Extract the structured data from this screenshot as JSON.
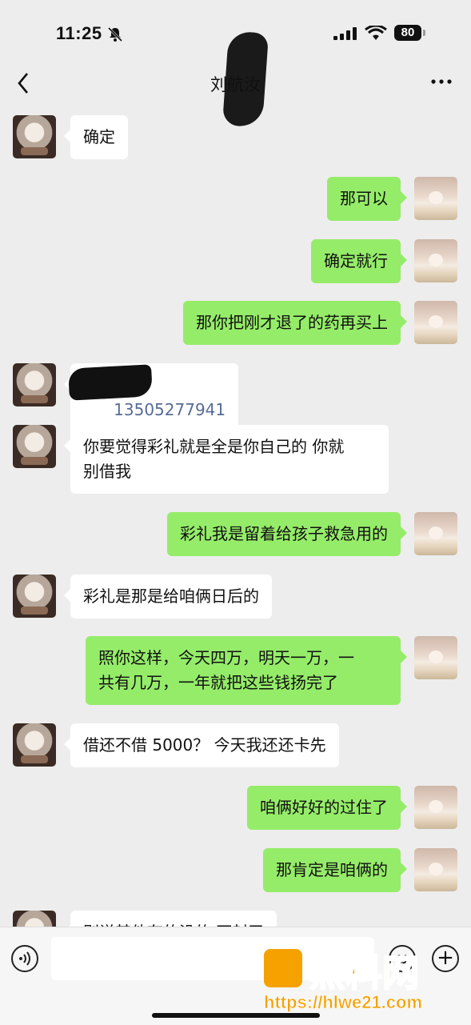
{
  "status_bar": {
    "time": "11:25",
    "battery": "80"
  },
  "header": {
    "title": "刘航汝"
  },
  "messages": [
    {
      "from": "other",
      "text": "确定"
    },
    {
      "from": "me",
      "text": "那可以"
    },
    {
      "from": "me",
      "text": "确定就行"
    },
    {
      "from": "me",
      "text": "那你把刚才退了的药再买上"
    },
    {
      "from": "other",
      "text": "13505277941"
    },
    {
      "from": "other",
      "text": "你要觉得彩礼就是全是你自己的 你就\n别借我"
    },
    {
      "from": "me",
      "text": "彩礼我是留着给孩子救急用的"
    },
    {
      "from": "other",
      "text": "彩礼是那是给咱俩日后的"
    },
    {
      "from": "me",
      "text": "照你这样，今天四万，明天一万，一\n共有几万，一年就把这些钱扬完了"
    },
    {
      "from": "other",
      "text": "借还不借 5000？ 今天我还还卡先"
    },
    {
      "from": "me",
      "text": "咱俩好好的过住了"
    },
    {
      "from": "me",
      "text": "那肯定是咱俩的"
    },
    {
      "from": "other",
      "text": "别说其他有的没的 不封了"
    }
  ],
  "watermark": {
    "text": "黑料网",
    "url": "https://hlwe21.com"
  },
  "colors": {
    "me_bubble": "#95ec69",
    "other_bubble": "#ffffff",
    "background": "#ededed",
    "watermark": "#f5a100"
  }
}
